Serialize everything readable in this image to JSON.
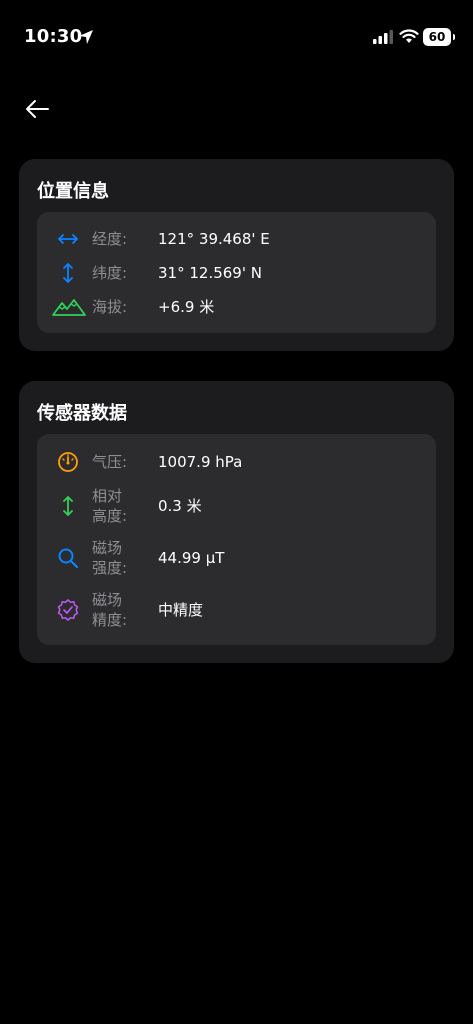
{
  "status_bar": {
    "time": "10:30",
    "battery": "60"
  },
  "location_card": {
    "title": "位置信息",
    "rows": [
      {
        "label": "经度:",
        "value": "121° 39.468' E",
        "icon": "horizontal-arrows-icon",
        "color": "#0a84ff"
      },
      {
        "label": "纬度:",
        "value": "31° 12.569' N",
        "icon": "vertical-arrows-icon",
        "color": "#0a84ff"
      },
      {
        "label": "海拔:",
        "value": "+6.9 米",
        "icon": "mountain-icon",
        "color": "#30d158"
      }
    ]
  },
  "sensor_card": {
    "title": "传感器数据",
    "rows": [
      {
        "label_line1": "气压:",
        "value": "1007.9 hPa",
        "icon": "gauge-icon",
        "color": "#ff9f0a"
      },
      {
        "label_line1": "相对",
        "label_line2": "高度:",
        "value": "0.3 米",
        "icon": "vertical-arrows-icon",
        "color": "#30d158"
      },
      {
        "label_line1": "磁场",
        "label_line2": "强度:",
        "value": "44.99 µT",
        "icon": "magnifier-icon",
        "color": "#0a84ff"
      },
      {
        "label_line1": "磁场",
        "label_line2": "精度:",
        "value": "中精度",
        "icon": "verified-badge-icon",
        "color": "#bf5af2"
      }
    ]
  }
}
